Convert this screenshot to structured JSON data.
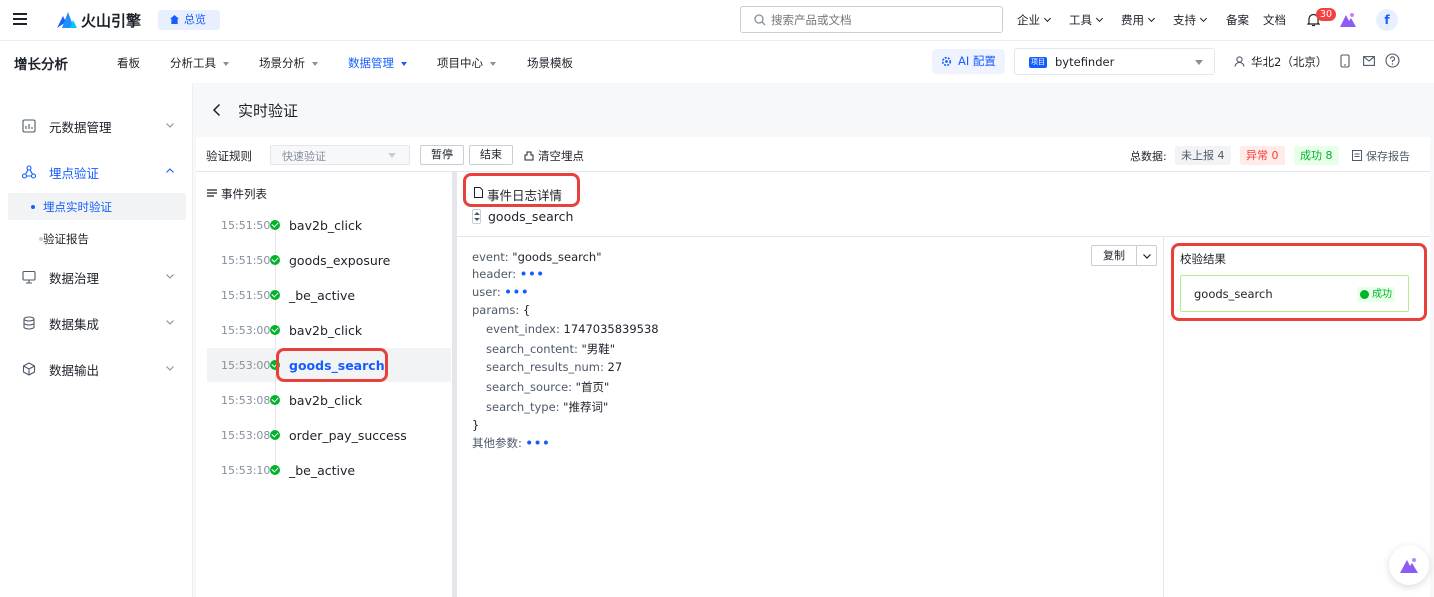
{
  "topbar": {
    "brand": "火山引擎",
    "overview_label": "总览",
    "search_placeholder": "搜索产品或文档",
    "menus": [
      "企业",
      "工具",
      "费用",
      "支持"
    ],
    "links": [
      "备案",
      "文档"
    ],
    "notification_count": "30",
    "avatar_letter": "f"
  },
  "appbar": {
    "title": "增长分析",
    "tabs": [
      {
        "label": "看板"
      },
      {
        "label": "分析工具"
      },
      {
        "label": "场景分析"
      },
      {
        "label": "数据管理"
      },
      {
        "label": "项目中心"
      },
      {
        "label": "场景模板"
      }
    ],
    "ai_label": "AI 配置",
    "project_tag": "项目",
    "project_name": "bytefinder",
    "region": "华北2（北京）",
    "colors": {
      "accent": "#165dff",
      "active_tab": "#165dff"
    }
  },
  "sidebar": {
    "items": [
      {
        "label": "元数据管理"
      },
      {
        "label": "埋点验证"
      },
      {
        "label": "数据治理"
      },
      {
        "label": "数据集成"
      },
      {
        "label": "数据输出"
      }
    ],
    "subitems": [
      {
        "label": "埋点实时验证"
      },
      {
        "label": "验证报告"
      }
    ]
  },
  "page": {
    "title": "实时验证",
    "rule_label": "验证规则",
    "rule_value": "快速验证",
    "pause_label": "暂停",
    "end_label": "结束",
    "clear_label": "清空埋点",
    "total_label": "总数据:",
    "stats": {
      "not_reported": "未上报 4",
      "abnormal": "异常 0",
      "success": "成功 8"
    },
    "save_report_label": "保存报告"
  },
  "event_list": {
    "title": "事件列表",
    "events": [
      {
        "time": "15:51:50",
        "name": "bav2b_click"
      },
      {
        "time": "15:51:50",
        "name": "goods_exposure"
      },
      {
        "time": "15:51:50",
        "name": "_be_active"
      },
      {
        "time": "15:53:00",
        "name": "bav2b_click"
      },
      {
        "time": "15:53:00",
        "name": "goods_search"
      },
      {
        "time": "15:53:08",
        "name": "bav2b_click"
      },
      {
        "time": "15:53:08",
        "name": "order_pay_success"
      },
      {
        "time": "15:53:10",
        "name": "_be_active"
      }
    ]
  },
  "detail": {
    "title": "事件日志详情",
    "event_name": "goods_search",
    "copy_label": "复制",
    "code": {
      "event_key": "event:",
      "event_val": "\"goods_search\"",
      "header_key": "header:",
      "user_key": "user:",
      "params_key": "params:",
      "open_brace": "{",
      "close_brace": "}",
      "dots": "•••",
      "other_key": "其他参数:",
      "params": [
        {
          "k": "event_index:",
          "v": "1747035839538"
        },
        {
          "k": "search_content:",
          "v": "\"男鞋\""
        },
        {
          "k": "search_results_num:",
          "v": "27"
        },
        {
          "k": "search_source:",
          "v": "\"首页\""
        },
        {
          "k": "search_type:",
          "v": "\"推荐词\""
        }
      ]
    }
  },
  "result": {
    "title": "校验结果",
    "event_name": "goods_search",
    "status": "成功"
  }
}
